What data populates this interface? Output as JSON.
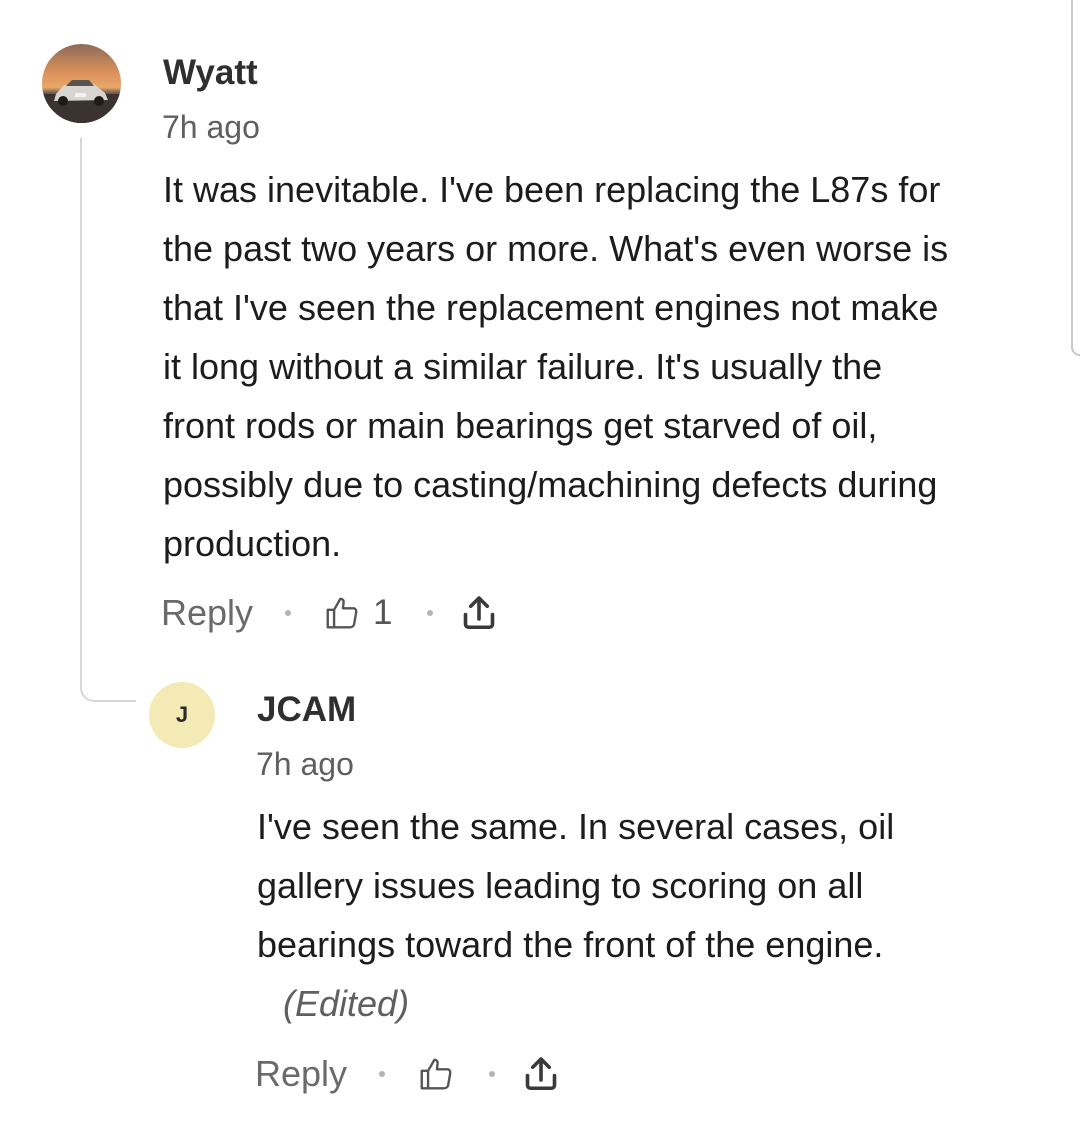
{
  "comments": [
    {
      "author": "Wyatt",
      "time": "7h ago",
      "body_lines": [
        "It was inevitable. I've been replacing the L87s for",
        "the past two years or more. What's even worse is",
        "that I've seen the replacement engines not make",
        "it long without a similar failure. It's usually the",
        "front rods or main bearings get starved of oil,",
        "possibly due to casting/machining defects during",
        "production."
      ],
      "reply_label": "Reply",
      "like_count": "1",
      "avatar_icon": "car-sunset-photo-avatar",
      "like_icon": "thumbs-up-icon",
      "share_icon": "share-icon"
    },
    {
      "author": "JCAM",
      "avatar_letter": "J",
      "time": "7h ago",
      "body_lines": [
        "I've seen the same. In several cases, oil",
        "gallery issues leading to scoring on all",
        "bearings toward the front of the engine."
      ],
      "edited_label": "(Edited)",
      "reply_label": "Reply",
      "like_icon": "thumbs-up-icon",
      "share_icon": "share-icon"
    }
  ],
  "colors": {
    "avatar_letter_bg": "#f3eab6",
    "thread_line": "#d6d6d6",
    "secondary_text": "#6a6a6a"
  }
}
